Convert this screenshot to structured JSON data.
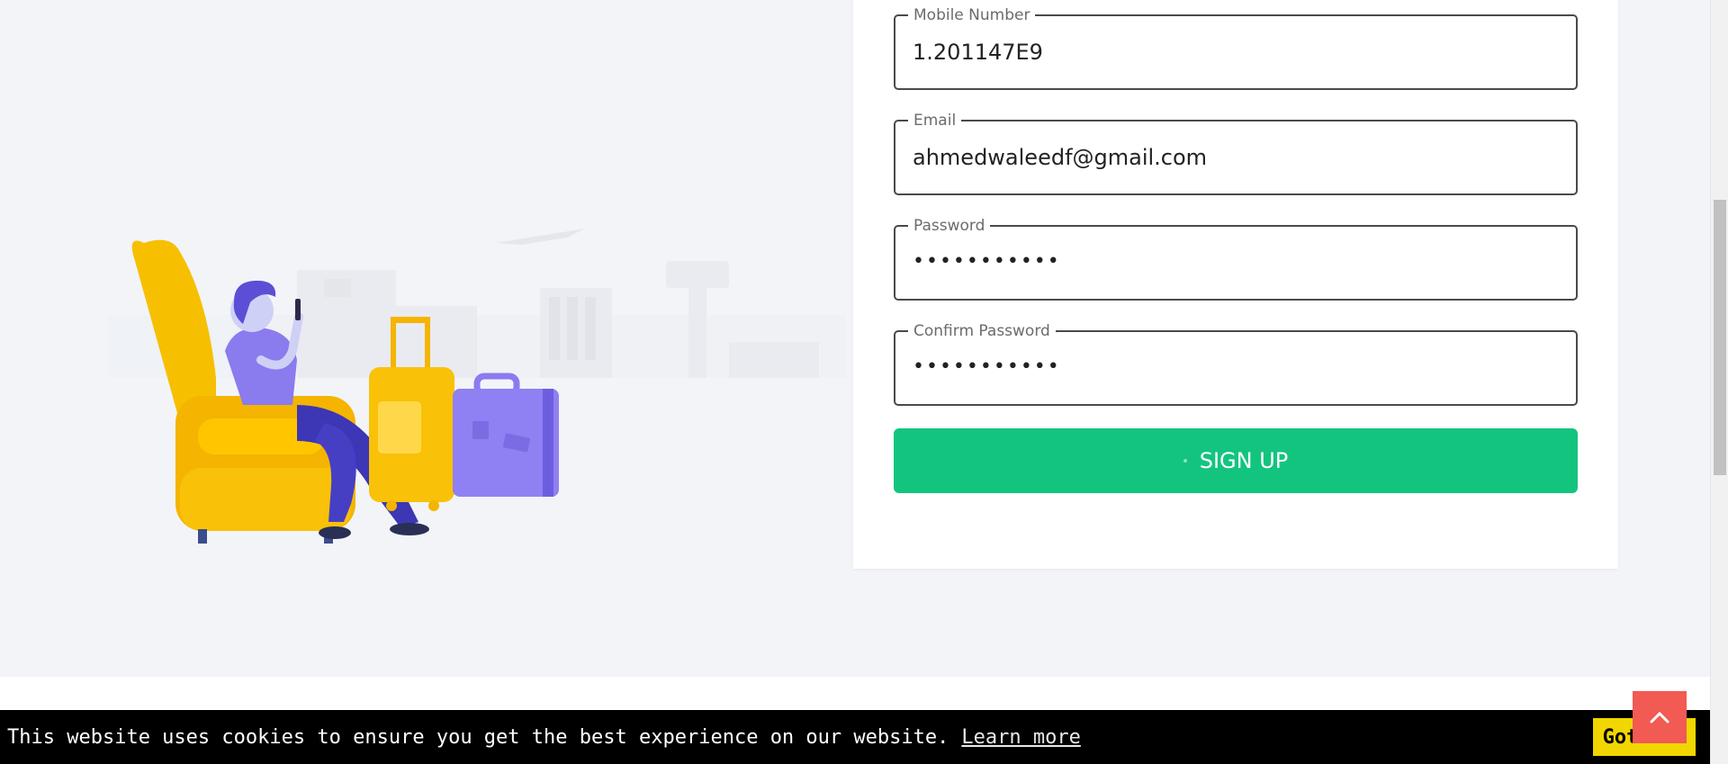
{
  "form": {
    "fields": [
      {
        "label": "Mobile Number",
        "value": "1.201147E9"
      },
      {
        "label": "Email",
        "value": "ahmedwaleedf@gmail.com"
      },
      {
        "label": "Password",
        "value": "•••••••••••"
      },
      {
        "label": "Confirm Password",
        "value": "•••••••••••"
      }
    ],
    "submit_label": "SIGN UP"
  },
  "cookie_banner": {
    "message": "This website uses cookies to ensure you get the best experience on our website.",
    "link_label": "Learn more",
    "accept_label": "Got it!"
  },
  "colors": {
    "accent": "#13c47f",
    "background": "#f2f4f8",
    "back_to_top": "#f25a54",
    "cookie_button": "#f1d600"
  },
  "icons": {
    "back_to_top": "chevron-up-icon",
    "illustration": "traveler-waiting-illustration"
  }
}
